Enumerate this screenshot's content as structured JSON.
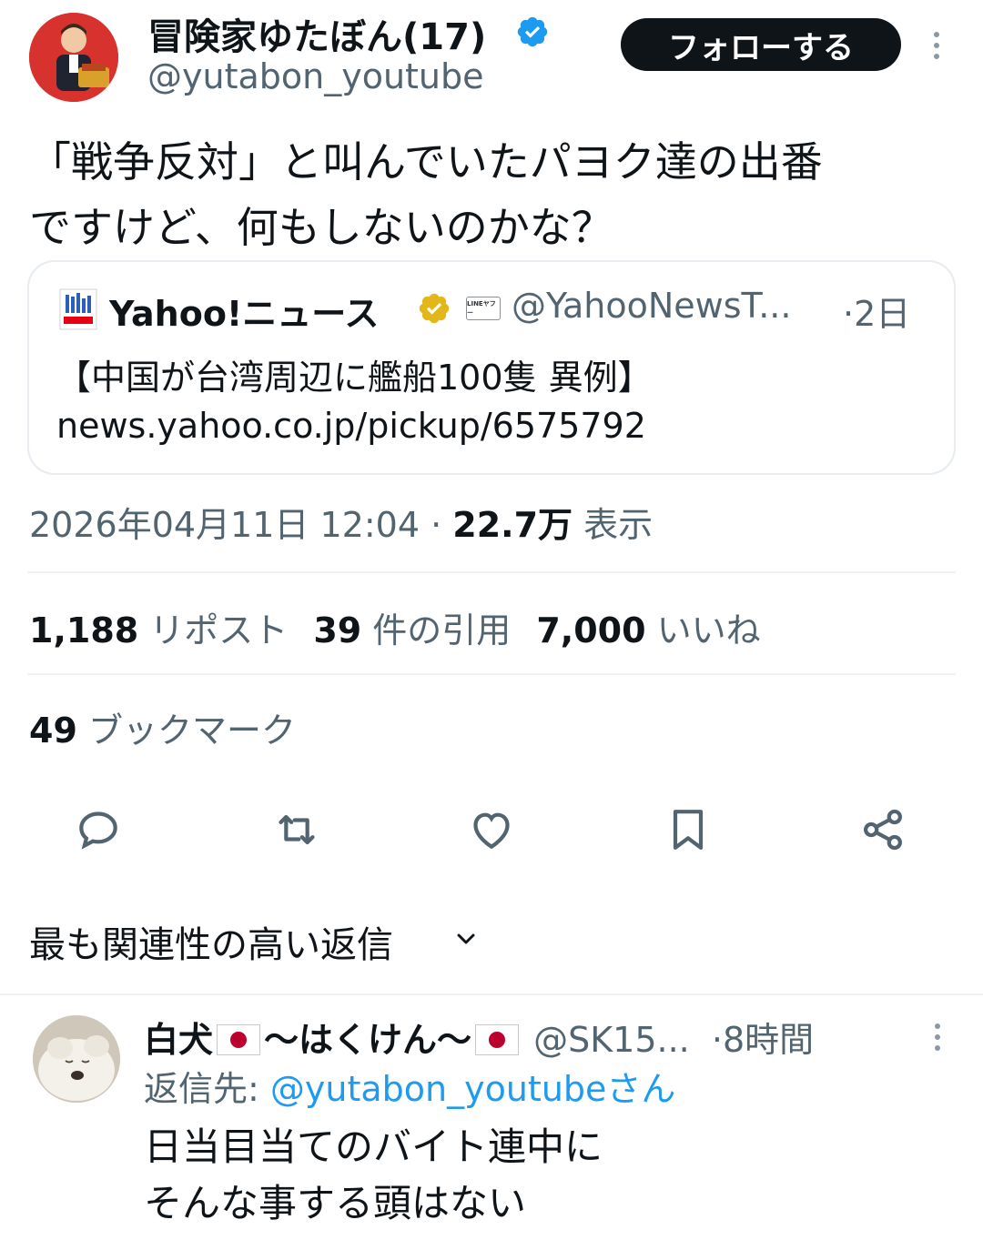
{
  "tweet": {
    "display_name": "冒険家ゆたぼん(17)",
    "handle": "@yutabon_youtube",
    "follow_label": "フォローする",
    "text": "「戦争反対」と叫んでいたパヨク達の出番\nですけど、何もしないのかな？",
    "verified_color": "#1d9bf0"
  },
  "quote": {
    "name": "Yahoo!ニュース",
    "badge_text": "LINEヤフー",
    "handle": "@YahooNewsT...",
    "time": "·2日",
    "title": "【中国が台湾周辺に艦船100隻 異例】",
    "link": "news.yahoo.co.jp/pickup/6575792",
    "verified_color": "#e2b719"
  },
  "meta": {
    "datetime": "2026年04月11日 12:04 · ",
    "views": "22.7万",
    "views_label": " 表示"
  },
  "stats": {
    "reposts": "1,188",
    "reposts_label": "リポスト",
    "quotes": "39",
    "quotes_label": "件の引用",
    "likes": "7,000",
    "likes_label": "いいね",
    "bookmarks": "49",
    "bookmarks_label": "ブックマーク"
  },
  "actions": [
    "reply-icon",
    "retweet-icon",
    "like-icon",
    "bookmark-icon",
    "share-icon"
  ],
  "sort": {
    "label": "最も関連性の高い返信"
  },
  "reply": {
    "name_part1": "白犬",
    "name_part2": "〜はくけん〜",
    "handle": "@SK15...",
    "time": "·8時間",
    "reply_to_label": "返信先: ",
    "reply_to_handle": "@yutabon_youtubeさん",
    "text": "日当目当てのバイト連中に\nそんな事する頭はない"
  },
  "colors": {
    "text": "#0f1419",
    "secondary": "#536471",
    "link": "#1d9bf0",
    "divider": "#eff3f4"
  }
}
